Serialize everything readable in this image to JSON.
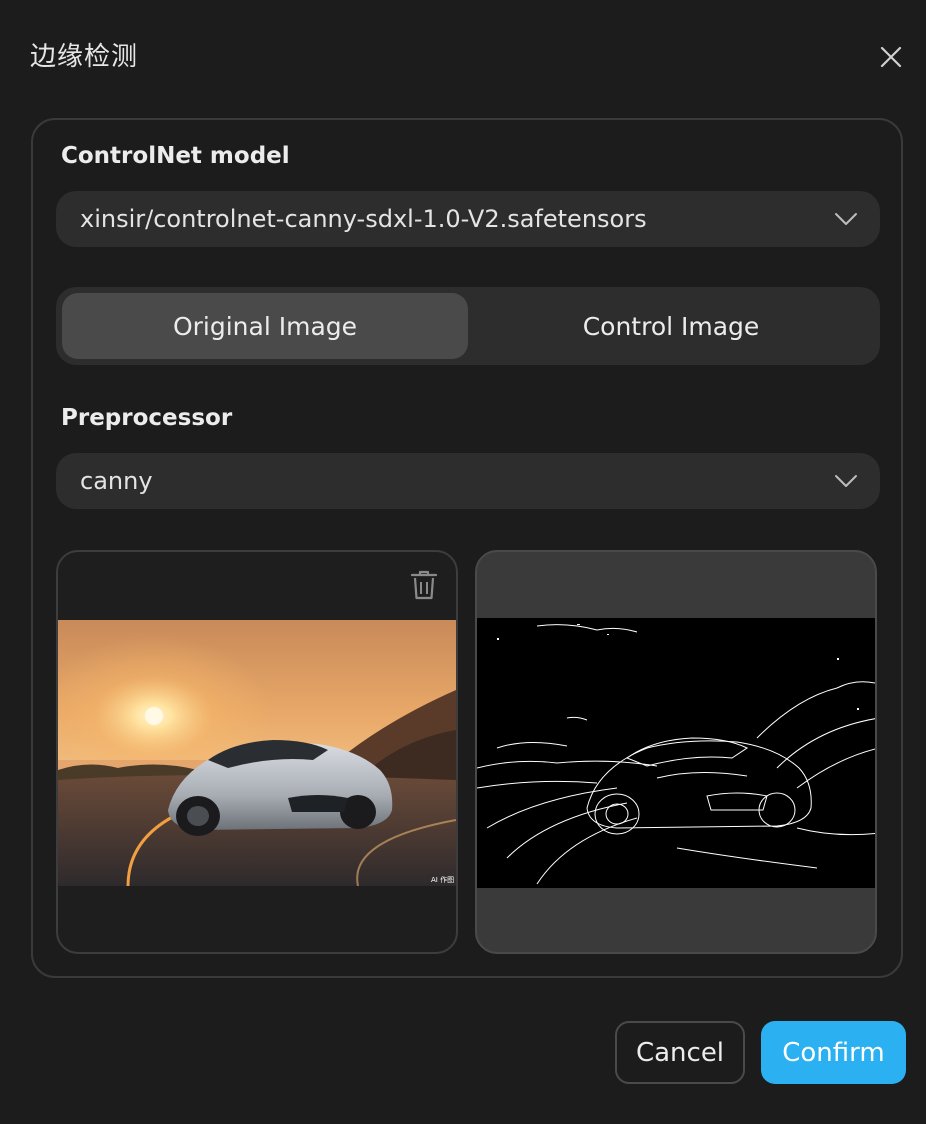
{
  "dialog": {
    "title": "边缘检测",
    "close_icon": "close-icon"
  },
  "controlnet": {
    "label": "ControlNet model",
    "selected": "xinsir/controlnet-canny-sdxl-1.0-V2.safetensors"
  },
  "tabs": [
    {
      "label": "Original Image",
      "active": true
    },
    {
      "label": "Control Image",
      "active": false
    }
  ],
  "preprocessor": {
    "label": "Preprocessor",
    "selected": "canny"
  },
  "images": {
    "original_icon": "trash-icon",
    "watermark": "AI 作图"
  },
  "buttons": {
    "cancel": "Cancel",
    "confirm": "Confirm"
  },
  "colors": {
    "background": "#1c1c1c",
    "surface": "#2d2d2d",
    "accent": "#2bb1f2"
  }
}
